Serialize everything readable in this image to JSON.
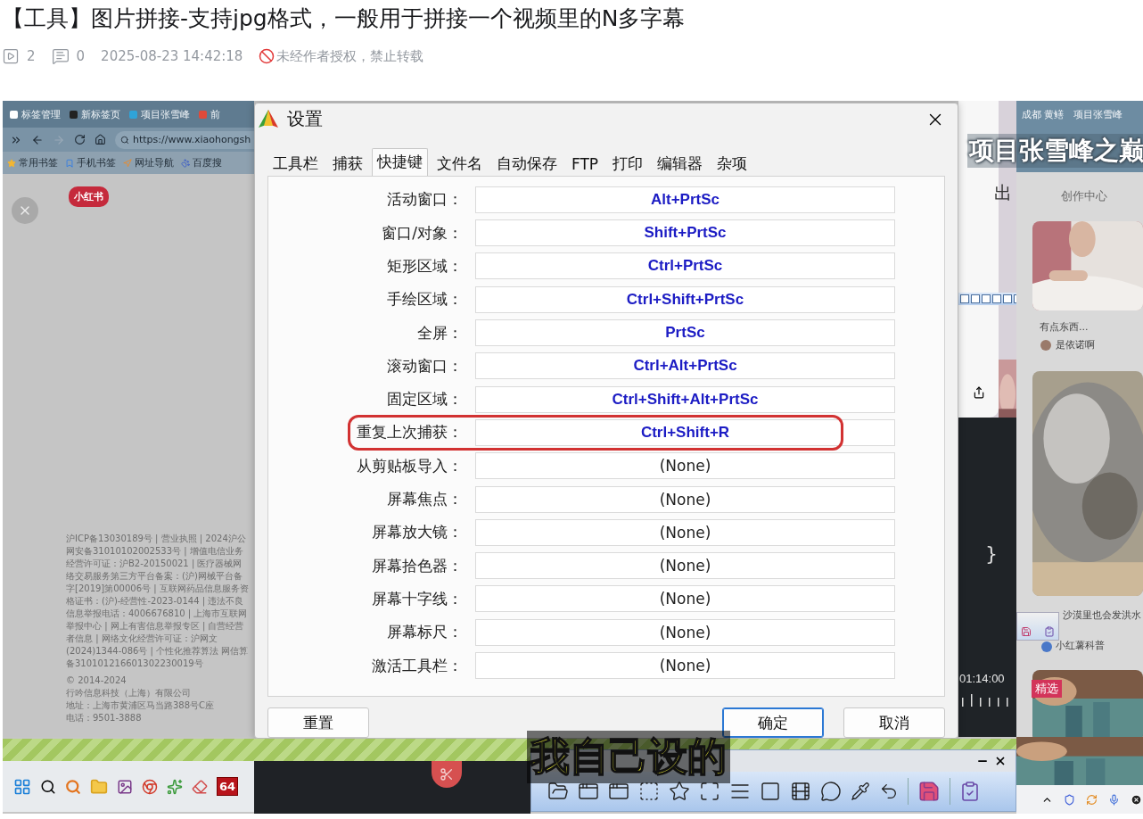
{
  "post": {
    "title": "【工具】图片拼接-支持jpg格式，一般用于拼接一个视频里的N多字幕",
    "plays": "2",
    "comments": "0",
    "date": "2025-08-23 14:42:18",
    "notice": "未经作者授权，禁止转载"
  },
  "browser": {
    "tabs": [
      "标签管理",
      "新标签页",
      "项目张雪峰",
      "前"
    ],
    "url": "https://www.xiaohongsh",
    "bookmarks": [
      "常用书签",
      "手机书签",
      "网址导航",
      "百度搜"
    ],
    "logo": "小红书",
    "footer": "沪ICP备13030189号 | 营业执照 | 2024沪公网安备31010102002533号 | 增值电信业务经营许可证：沪B2-20150021 | 医疗器械网络交易服务第三方平台备案：(沪)网械平台备字[2019]第00006号 | 互联网药品信息服务资格证书：(沪)-经营性-2023-0144 | 违法不良信息举报电话：4006676810 | 上海市互联网举报中心 | 网上有害信息举报专区 | 自营经营者信息 | 网络文化经营许可证：沪网文(2024)1344-086号 | 个性化推荐算法 网信算备310101216601302230019号",
    "copyright": [
      "© 2014-2024",
      "行吟信息科技（上海）有限公司",
      "地址：上海市黄浦区马当路388号C座",
      "电话：9501-3888"
    ]
  },
  "dialog": {
    "title": "设置",
    "tabs": [
      {
        "label": "工具栏",
        "selected": false
      },
      {
        "label": "捕获",
        "selected": false
      },
      {
        "label": "快捷键",
        "selected": true
      },
      {
        "label": "文件名",
        "selected": false
      },
      {
        "label": "自动保存",
        "selected": false
      },
      {
        "label": "FTP",
        "selected": false
      },
      {
        "label": "打印",
        "selected": false
      },
      {
        "label": "编辑器",
        "selected": false
      },
      {
        "label": "杂项",
        "selected": false
      }
    ],
    "rows": [
      {
        "label": "活动窗口：",
        "value": "Alt+PrtSc",
        "assigned": true,
        "highlighted": false
      },
      {
        "label": "窗口/对象：",
        "value": "Shift+PrtSc",
        "assigned": true,
        "highlighted": false
      },
      {
        "label": "矩形区域：",
        "value": "Ctrl+PrtSc",
        "assigned": true,
        "highlighted": false
      },
      {
        "label": "手绘区域：",
        "value": "Ctrl+Shift+PrtSc",
        "assigned": true,
        "highlighted": false
      },
      {
        "label": "全屏：",
        "value": "PrtSc",
        "assigned": true,
        "highlighted": false
      },
      {
        "label": "滚动窗口：",
        "value": "Ctrl+Alt+PrtSc",
        "assigned": true,
        "highlighted": false
      },
      {
        "label": "固定区域：",
        "value": "Ctrl+Shift+Alt+PrtSc",
        "assigned": true,
        "highlighted": false
      },
      {
        "label": "重复上次捕获：",
        "value": "Ctrl+Shift+R",
        "assigned": true,
        "highlighted": true
      },
      {
        "label": "从剪贴板导入：",
        "value": "(None)",
        "assigned": false,
        "highlighted": false
      },
      {
        "label": "屏幕焦点：",
        "value": "(None)",
        "assigned": false,
        "highlighted": false
      },
      {
        "label": "屏幕放大镜：",
        "value": "(None)",
        "assigned": false,
        "highlighted": false
      },
      {
        "label": "屏幕拾色器：",
        "value": "(None)",
        "assigned": false,
        "highlighted": false
      },
      {
        "label": "屏幕十字线：",
        "value": "(None)",
        "assigned": false,
        "highlighted": false
      },
      {
        "label": "屏幕标尺：",
        "value": "(None)",
        "assigned": false,
        "highlighted": false
      },
      {
        "label": "激活工具栏：",
        "value": "(None)",
        "assigned": false,
        "highlighted": false
      }
    ],
    "buttons": [
      {
        "label": "重置",
        "default": false
      },
      {
        "label": "确定",
        "default": true
      },
      {
        "label": "取消",
        "default": false
      }
    ]
  },
  "middle": {
    "fragment": "出",
    "brace": "}",
    "timecode": "01:14:00"
  },
  "feed": {
    "tabs": [
      "成都 黄鳝",
      "项目张雪峰"
    ],
    "heading": "创作中心",
    "cards": [
      {
        "title": "有点东西...",
        "author": "是依诺啊"
      },
      {
        "title": "沙漠里也会发洪水",
        "author": "小红薯科普"
      }
    ],
    "badge": "精选"
  },
  "overlay_caption": "项目张雪峰之巅",
  "subtitle": "我自己设的",
  "taskbar": {
    "badge": "64"
  }
}
